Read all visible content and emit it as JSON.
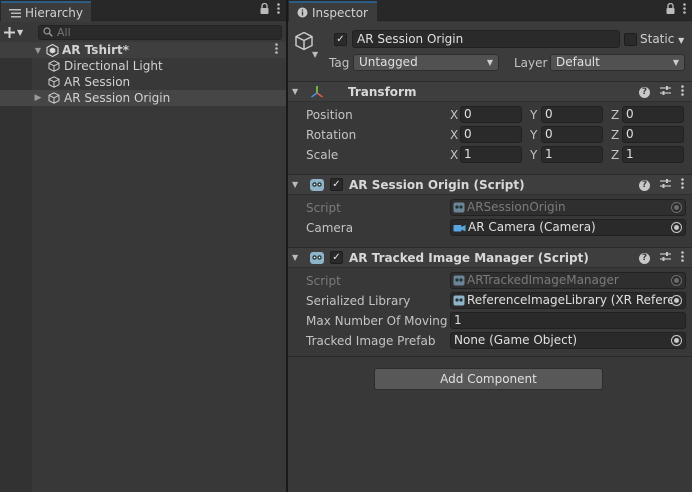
{
  "hierarchy": {
    "tab_title": "Hierarchy",
    "search_placeholder": "All",
    "scene_name": "AR Tshirt*",
    "items": [
      {
        "label": "Directional Light"
      },
      {
        "label": "AR Session"
      },
      {
        "label": "AR Session Origin"
      }
    ]
  },
  "inspector": {
    "tab_title": "Inspector",
    "object_name": "AR Session Origin",
    "static_label": "Static",
    "tag_label": "Tag",
    "tag_value": "Untagged",
    "layer_label": "Layer",
    "layer_value": "Default",
    "transform": {
      "title": "Transform",
      "position_label": "Position",
      "rotation_label": "Rotation",
      "scale_label": "Scale",
      "axis_x": "X",
      "axis_y": "Y",
      "axis_z": "Z",
      "position": {
        "x": "0",
        "y": "0",
        "z": "0"
      },
      "rotation": {
        "x": "0",
        "y": "0",
        "z": "0"
      },
      "scale": {
        "x": "1",
        "y": "1",
        "z": "1"
      }
    },
    "session_origin": {
      "title": "AR Session Origin (Script)",
      "script_label": "Script",
      "script_value": "ARSessionOrigin",
      "camera_label": "Camera",
      "camera_value": "AR Camera (Camera)"
    },
    "tracked_image_manager": {
      "title": "AR Tracked Image Manager (Script)",
      "script_label": "Script",
      "script_value": "ARTrackedImageManager",
      "library_label": "Serialized Library",
      "library_value": "ReferenceImageLibrary (XR Referen",
      "max_label": "Max Number Of Moving Ir",
      "max_value": "1",
      "prefab_label": "Tracked Image Prefab",
      "prefab_value": "None (Game Object)"
    },
    "add_component_label": "Add Component"
  },
  "colors": {
    "panel_bg": "#383838",
    "tab_accent": "#2c5d87",
    "field_bg": "#2a2a2a",
    "text": "#c4c4c4"
  },
  "icons": [
    "lock-icon",
    "kebab-menu-icon",
    "info-icon",
    "cube-icon",
    "unity-scene-icon",
    "transform-axes-icon",
    "script-icon",
    "help-icon",
    "preset-icon",
    "camera-icon",
    "object-picker-icon",
    "search-icon",
    "plus-icon"
  ]
}
